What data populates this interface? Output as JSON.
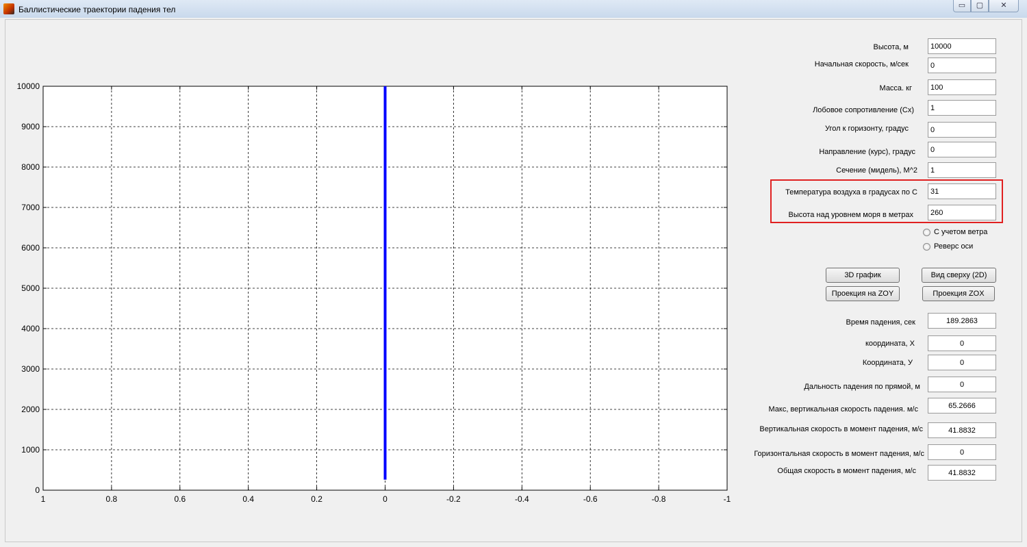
{
  "window": {
    "title": "Баллистические траектории падения тел",
    "buttons": {
      "minimize": "▭",
      "maximize": "▢",
      "close": "✕"
    }
  },
  "inputs": [
    {
      "label": "Высота, м",
      "value": "10000"
    },
    {
      "label": "Начальная скорость, м/сек",
      "value": "0"
    },
    {
      "label": "Масса. кг",
      "value": "100"
    },
    {
      "label": "Лобовое сопротивление (Cx)",
      "value": "1"
    },
    {
      "label": "Угол к горизонту, градус",
      "value": "0"
    },
    {
      "label": "Направление  (курс), градус",
      "value": "0"
    },
    {
      "label": "Сечение (мидель), М^2",
      "value": "1"
    },
    {
      "label": "Температура воздуха в градусах по С",
      "value": "31"
    },
    {
      "label": "Высота над уровнем моря в метрах",
      "value": "260"
    }
  ],
  "options": [
    {
      "label": "С учетом ветра",
      "checked": false
    },
    {
      "label": "Реверс оси",
      "checked": false
    }
  ],
  "buttons": {
    "plot3d": "3D график",
    "top_view": "Вид сверху (2D)",
    "proj_zoy": "Проекция на ZOY",
    "proj_zox": "Проекция ZOX"
  },
  "results": [
    {
      "label": "Время падения, сек",
      "value": "189.2863"
    },
    {
      "label": "координата, X",
      "value": "0"
    },
    {
      "label": "Координата, У",
      "value": "0"
    },
    {
      "label": "Дальность падения по прямой, м",
      "value": "0"
    },
    {
      "label": "Макс,  вертикальная скорость падения. м/с",
      "value": "65.2666"
    },
    {
      "label": "Вертикальная  скорость в момент падения, м/с",
      "value": "41.8832"
    },
    {
      "label": "Горизонтальная скорость в момент падения, м/с",
      "value": "0"
    },
    {
      "label": "Общая скорость в момент падения, м/с",
      "value": "41.8832"
    }
  ],
  "chart_data": {
    "type": "line",
    "xlim": [
      1,
      -1
    ],
    "ylim": [
      0,
      10000
    ],
    "x_ticks": [
      "1",
      "0.8",
      "0.6",
      "0.4",
      "0.2",
      "0",
      "-0.2",
      "-0.4",
      "-0.6",
      "-0.8",
      "-1"
    ],
    "y_ticks": [
      "0",
      "1000",
      "2000",
      "3000",
      "4000",
      "5000",
      "6000",
      "7000",
      "8000",
      "9000",
      "10000"
    ],
    "x_reversed": true,
    "grid": true,
    "grid_style": "dashed",
    "series": [
      {
        "color": "#0000ff",
        "x": [
          0,
          0
        ],
        "y": [
          10000,
          260
        ]
      }
    ]
  }
}
